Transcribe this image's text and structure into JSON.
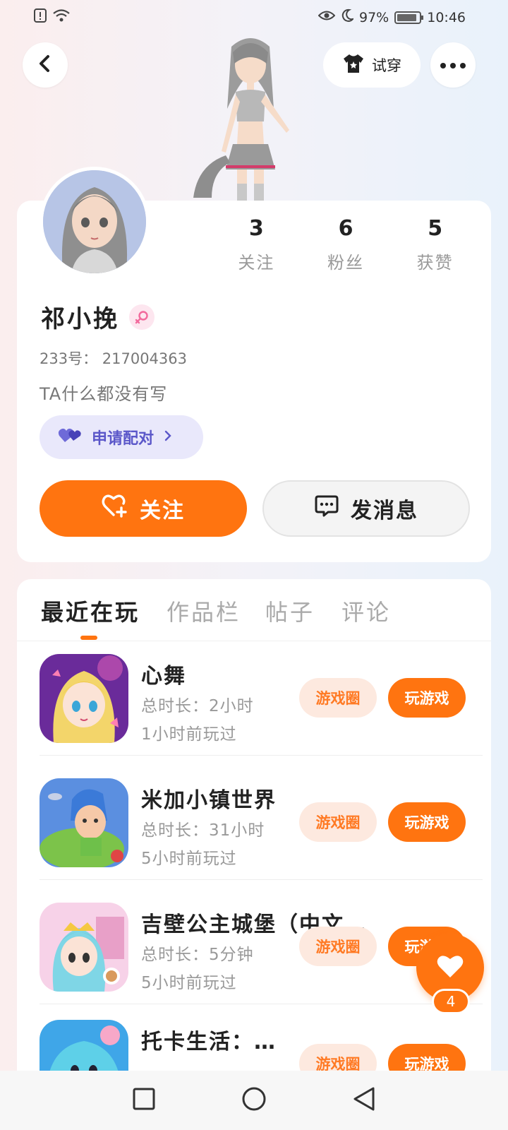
{
  "status_bar": {
    "battery": "97%",
    "time": "10:46",
    "icons": [
      "alert-icon",
      "wifi-icon",
      "eye-icon",
      "moon-icon",
      "battery-icon"
    ]
  },
  "header": {
    "try_on_label": "试穿",
    "icons": [
      "back-icon",
      "tshirt-icon",
      "more-icon"
    ]
  },
  "profile": {
    "stats": [
      {
        "value": "3",
        "label": "关注"
      },
      {
        "value": "6",
        "label": "粉丝"
      },
      {
        "value": "5",
        "label": "获赞"
      }
    ],
    "username": "祁小挽",
    "user_id": "233号： 217004363",
    "bio": "TA什么都没有写",
    "pair_label": "申请配对",
    "follow_label": "关注",
    "message_label": "发消息"
  },
  "tabs": [
    {
      "label": "最近在玩",
      "active": true
    },
    {
      "label": "作品栏",
      "active": false
    },
    {
      "label": "帖子",
      "active": false
    },
    {
      "label": "评论",
      "active": false
    }
  ],
  "games": [
    {
      "title": "心舞",
      "duration": "总时长：2小时",
      "last_played": "1小时前玩过",
      "circle_label": "游戏圈",
      "play_label": "玩游戏"
    },
    {
      "title": "米加小镇世界",
      "duration": "总时长：31小时",
      "last_played": "5小时前玩过",
      "circle_label": "游戏圈",
      "play_label": "玩游戏"
    },
    {
      "title": "吉壁公主城堡（中文…",
      "duration": "总时长：5分钟",
      "last_played": "5小时前玩过",
      "circle_label": "游戏圈",
      "play_label": "玩游戏"
    },
    {
      "title": "托卡生活：…",
      "duration": "",
      "last_played": "",
      "circle_label": "游戏圈",
      "play_label": "玩游戏"
    }
  ],
  "float_like": {
    "count": "4"
  },
  "colors": {
    "accent": "#ff7410",
    "accent_light": "#fde9df",
    "pair_bg": "#e9e8fb",
    "pair_text": "#5b57c9"
  }
}
